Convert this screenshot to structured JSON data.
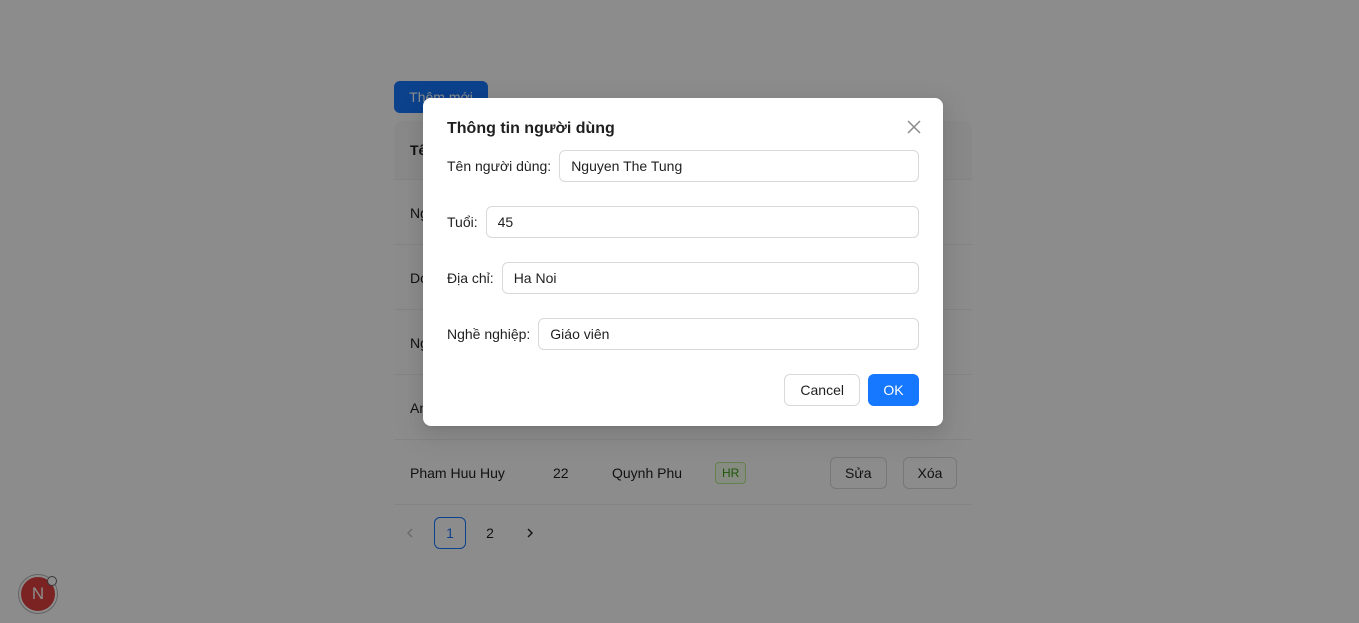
{
  "page": {
    "add_button": "Thêm mới",
    "table": {
      "header_first": "Tê",
      "rows": [
        {
          "name": "Ng",
          "age": "",
          "address": "",
          "job": "",
          "edit": "",
          "delete": ""
        },
        {
          "name": "Do",
          "age": "",
          "address": "",
          "job": "",
          "edit": "",
          "delete": ""
        },
        {
          "name": "Ng",
          "age": "",
          "address": "",
          "job": "",
          "edit": "",
          "delete": ""
        },
        {
          "name": "An",
          "age": "",
          "address": "",
          "job": "",
          "edit": "",
          "delete": ""
        },
        {
          "name": "Pham Huu Huy",
          "age": "22",
          "address": "Quynh Phu",
          "job": "HR",
          "edit": "Sửa",
          "delete": "Xóa"
        }
      ]
    },
    "pagination": {
      "prev": "<",
      "pages": [
        "1",
        "2"
      ],
      "active": "1",
      "next": ">"
    },
    "dev_badge": "N"
  },
  "modal": {
    "title": "Thông tin người dùng",
    "close_icon": "close-icon",
    "fields": {
      "name": {
        "label": "Tên người dùng",
        "value": "Nguyen The Tung"
      },
      "age": {
        "label": "Tuổi",
        "value": "45"
      },
      "address": {
        "label": "Địa chỉ",
        "value": "Ha Noi"
      },
      "job": {
        "label": "Nghề nghiệp",
        "value": "Giáo viên"
      }
    },
    "label_suffix": ":",
    "cancel": "Cancel",
    "ok": "OK"
  },
  "colors": {
    "primary": "#1677ff",
    "mask": "rgba(0,0,0,0.45)"
  }
}
